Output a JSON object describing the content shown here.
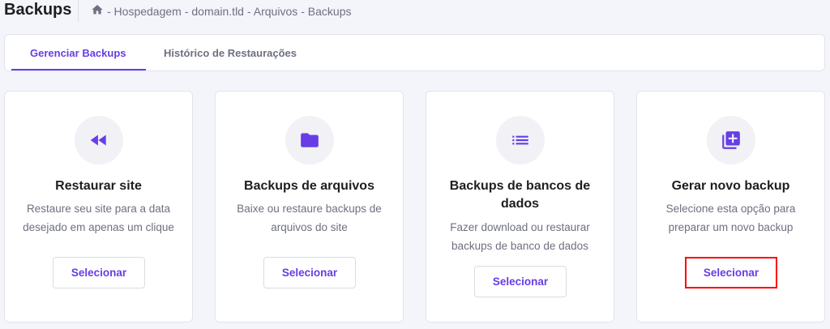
{
  "header": {
    "title": "Backups",
    "breadcrumb": [
      "- Hospedagem",
      "- domain.tld",
      "- Arquivos",
      "- Backups"
    ]
  },
  "tabs": [
    {
      "label": "Gerenciar Backups",
      "active": true
    },
    {
      "label": "Histórico de Restaurações",
      "active": false
    }
  ],
  "accent": "#673de6",
  "cards": [
    {
      "icon": "rewind-icon",
      "title": "Restaurar site",
      "desc": "Restaure seu site para a data desejado em apenas um clique",
      "button": "Selecionar"
    },
    {
      "icon": "folder-icon",
      "title": "Backups de arquivos",
      "desc": "Baixe ou restaure backups de arquivos do site",
      "button": "Selecionar"
    },
    {
      "icon": "list-icon",
      "title": "Backups de bancos de dados",
      "desc": "Fazer download ou restaurar backups de banco de dados",
      "button": "Selecionar"
    },
    {
      "icon": "add-library-icon",
      "title": "Gerar novo backup",
      "desc": "Selecione esta opção para preparar um novo backup",
      "button": "Selecionar"
    }
  ]
}
